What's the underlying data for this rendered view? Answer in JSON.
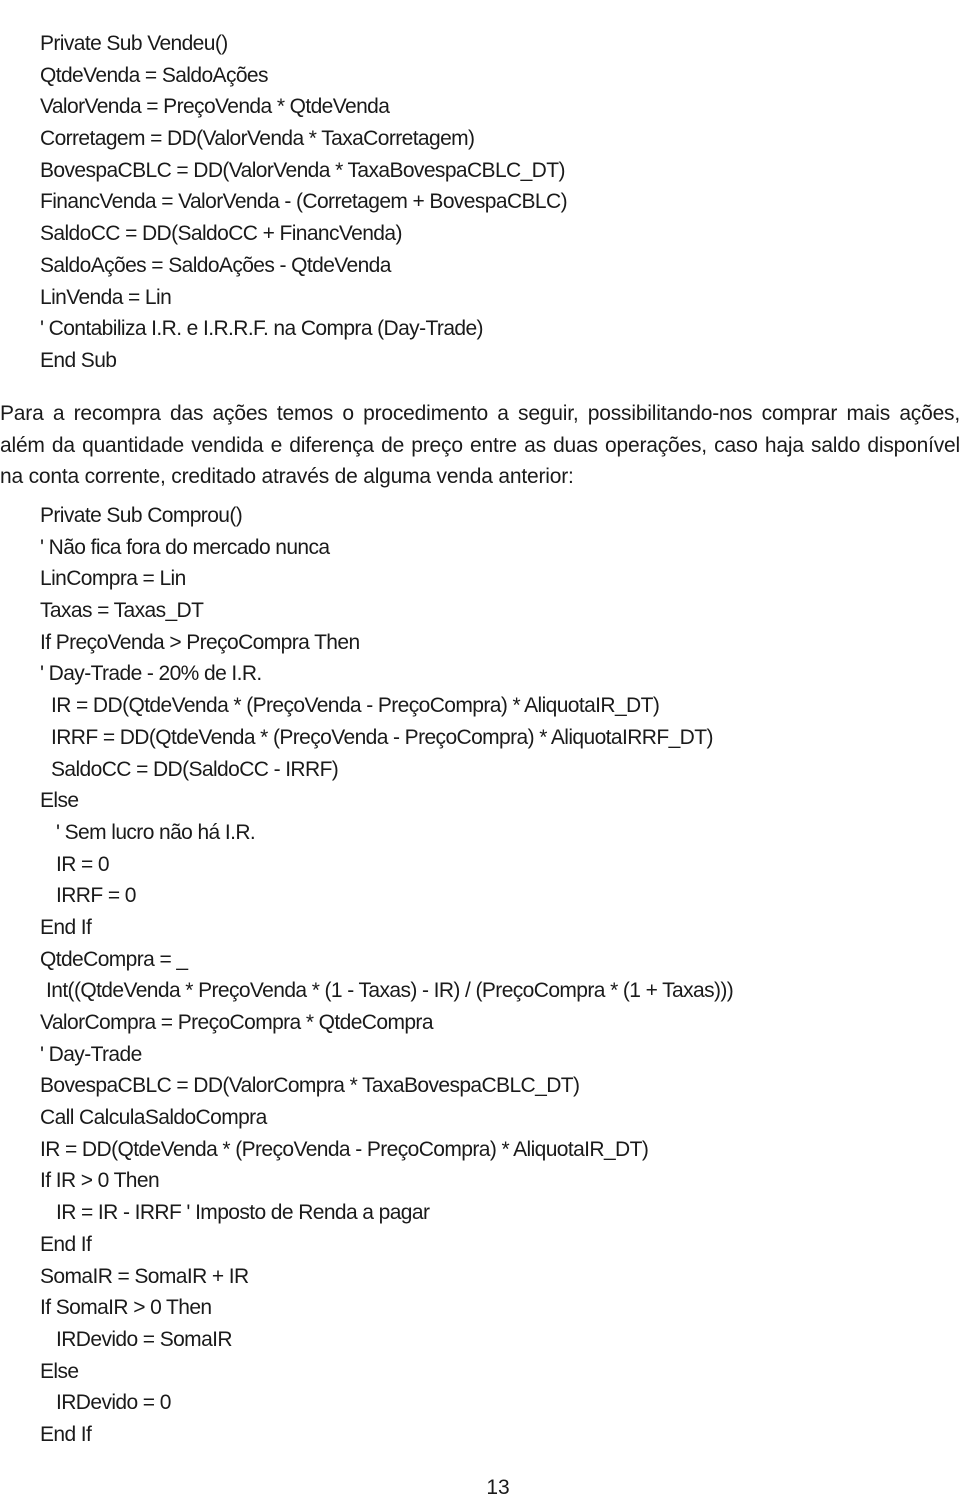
{
  "block1": {
    "lines": [
      "Private Sub Vendeu()",
      "QtdeVenda = SaldoAções",
      "ValorVenda = PreçoVenda * QtdeVenda",
      "Corretagem = DD(ValorVenda * TaxaCorretagem)",
      "BovespaCBLC = DD(ValorVenda * TaxaBovespaCBLC_DT)",
      "FinancVenda = ValorVenda - (Corretagem + BovespaCBLC)",
      "SaldoCC = DD(SaldoCC + FinancVenda)",
      "SaldoAções = SaldoAções - QtdeVenda",
      "LinVenda = Lin",
      "' Contabiliza I.R. e I.R.R.F. na Compra (Day-Trade)",
      "End Sub"
    ]
  },
  "paragraph": "Para a recompra das ações temos o procedimento a seguir, possibilitando-nos comprar mais ações, além da quantidade vendida e diferença de preço entre as duas operações, caso haja saldo disponível na conta corrente, creditado  através de alguma venda anterior:",
  "block2": {
    "lines": [
      "Private Sub Comprou()",
      "' Não fica fora do mercado nunca",
      "LinCompra = Lin",
      "Taxas = Taxas_DT",
      "If PreçoVenda > PreçoCompra Then",
      "' Day-Trade - 20% de I.R.",
      "IR = DD(QtdeVenda * (PreçoVenda - PreçoCompra) * AliquotaIR_DT)",
      "IRRF = DD(QtdeVenda * (PreçoVenda - PreçoCompra) * AliquotaIRRF_DT)",
      "SaldoCC = DD(SaldoCC - IRRF)",
      "Else",
      "' Sem lucro não há I.R.",
      "IR = 0",
      "IRRF = 0",
      "End If",
      "QtdeCompra = _",
      "Int((QtdeVenda * PreçoVenda * (1 - Taxas) - IR) / (PreçoCompra * (1 + Taxas)))",
      "ValorCompra = PreçoCompra * QtdeCompra",
      "' Day-Trade",
      "BovespaCBLC = DD(ValorCompra * TaxaBovespaCBLC_DT)",
      "Call CalculaSaldoCompra",
      "IR = DD(QtdeVenda * (PreçoVenda - PreçoCompra) * AliquotaIR_DT)",
      "If IR > 0 Then",
      "IR = IR - IRRF ' Imposto de Renda a pagar",
      "End If",
      "SomaIR = SomaIR + IR",
      "If SomaIR > 0 Then",
      "IRDevido = SomaIR",
      "Else",
      "IRDevido = 0",
      "End If"
    ]
  },
  "page_number": "13"
}
